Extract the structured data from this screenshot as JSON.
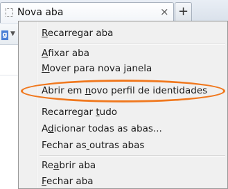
{
  "tab": {
    "title": "Nova aba",
    "close_glyph": "×",
    "new_tab_glyph": "+"
  },
  "background": {
    "search_engine_letter": "g",
    "dropdown_glyph": "▼"
  },
  "menu": {
    "items": [
      {
        "label": "Recarregar aba",
        "mnemonic_index": 0
      },
      {
        "label": "Afixar aba",
        "mnemonic_index": 0
      },
      {
        "label": "Mover para nova janela",
        "mnemonic_index": 0
      },
      {
        "label": "Abrir em novo perfil de identidades",
        "mnemonic_index": 9
      },
      {
        "label": "Recarregar tudo",
        "mnemonic_index": 11
      },
      {
        "label": "Adicionar todas as abas...",
        "mnemonic_index": 1
      },
      {
        "label": "Fechar as outras abas",
        "mnemonic_index": 9
      },
      {
        "label": "Reabrir aba",
        "mnemonic_index": 2
      },
      {
        "label": "Fechar aba",
        "mnemonic_index": 0
      }
    ]
  },
  "colors": {
    "highlight_ellipse": "#f0781e"
  }
}
